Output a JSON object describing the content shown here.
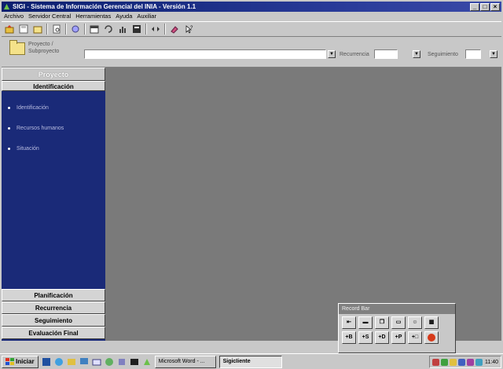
{
  "window": {
    "title": "SIGI - Sistema de Información Gerencial del INIA - Versión 1.1",
    "controls": [
      "_",
      "□",
      "×"
    ]
  },
  "menu": [
    "Archivo",
    "Servidor Central",
    "Herramientas",
    "Ayuda",
    "Auxiliar"
  ],
  "toolbar": {
    "icons": [
      "open-icon",
      "save-icon",
      "folder-icon",
      "print-preview-icon",
      "sync-icon",
      "calendar-icon",
      "reload-icon",
      "chart-icon",
      "report-icon",
      "arrows-icon",
      "eraser-icon",
      "help-icon"
    ]
  },
  "project_bar": {
    "label_line1": "Proyecto /",
    "label_line2": "Subproyecto",
    "recurrencia_label": "Recurrencia",
    "seguimiento_label": "Seguimiento",
    "project_value": "",
    "recurrencia_value": "",
    "seguimiento_value": ""
  },
  "sidebar": {
    "header": "Proyecto",
    "section": "Identificación",
    "items": [
      "Identificación",
      "Recursos humanos",
      "Situación"
    ],
    "bottom_sections": [
      "Planificación",
      "Recurrencia",
      "Seguimiento",
      "Evaluación Final"
    ]
  },
  "record_bar": {
    "title": "Record Bar",
    "row1": [
      "icon-a",
      "icon-b",
      "icon-c",
      "icon-d",
      "icon-e",
      "icon-f"
    ],
    "row2": [
      "+B",
      "+S",
      "+D",
      "+P",
      "+□",
      "stop"
    ]
  },
  "taskbar": {
    "start_label": "Iniciar",
    "tasks": [
      "Microsoft Word - ...",
      "SigicIiente"
    ],
    "clock": "11:40"
  },
  "colors": {
    "title_bar": "#0a1e6e",
    "sidebar": "#1a2a78",
    "workspace": "#7a7a7a",
    "stop_button": "#d63a1a"
  }
}
